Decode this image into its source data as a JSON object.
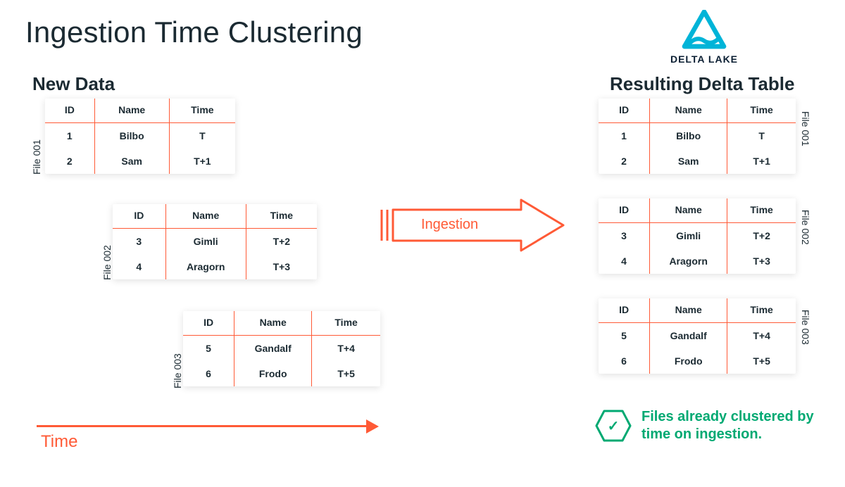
{
  "title": "Ingestion Time Clustering",
  "logo_label": "DELTA LAKE",
  "sections": {
    "new_data": "New Data",
    "result": "Resulting Delta Table"
  },
  "columns": {
    "id": "ID",
    "name": "Name",
    "time": "Time"
  },
  "files": [
    {
      "label": "File 001",
      "rows": [
        {
          "id": "1",
          "name": "Bilbo",
          "time": "T"
        },
        {
          "id": "2",
          "name": "Sam",
          "time": "T+1"
        }
      ]
    },
    {
      "label": "File 002",
      "rows": [
        {
          "id": "3",
          "name": "Gimli",
          "time": "T+2"
        },
        {
          "id": "4",
          "name": "Aragorn",
          "time": "T+3"
        }
      ]
    },
    {
      "label": "File 003",
      "rows": [
        {
          "id": "5",
          "name": "Gandalf",
          "time": "T+4"
        },
        {
          "id": "6",
          "name": "Frodo",
          "time": "T+5"
        }
      ]
    }
  ],
  "arrow_label": "Ingestion",
  "time_axis_label": "Time",
  "badge_text": "Files already clustered by time on ingestion.",
  "colors": {
    "orange": "#ff5a36",
    "green": "#00a972",
    "cyan": "#00b4d8",
    "navy": "#0b1f33"
  }
}
